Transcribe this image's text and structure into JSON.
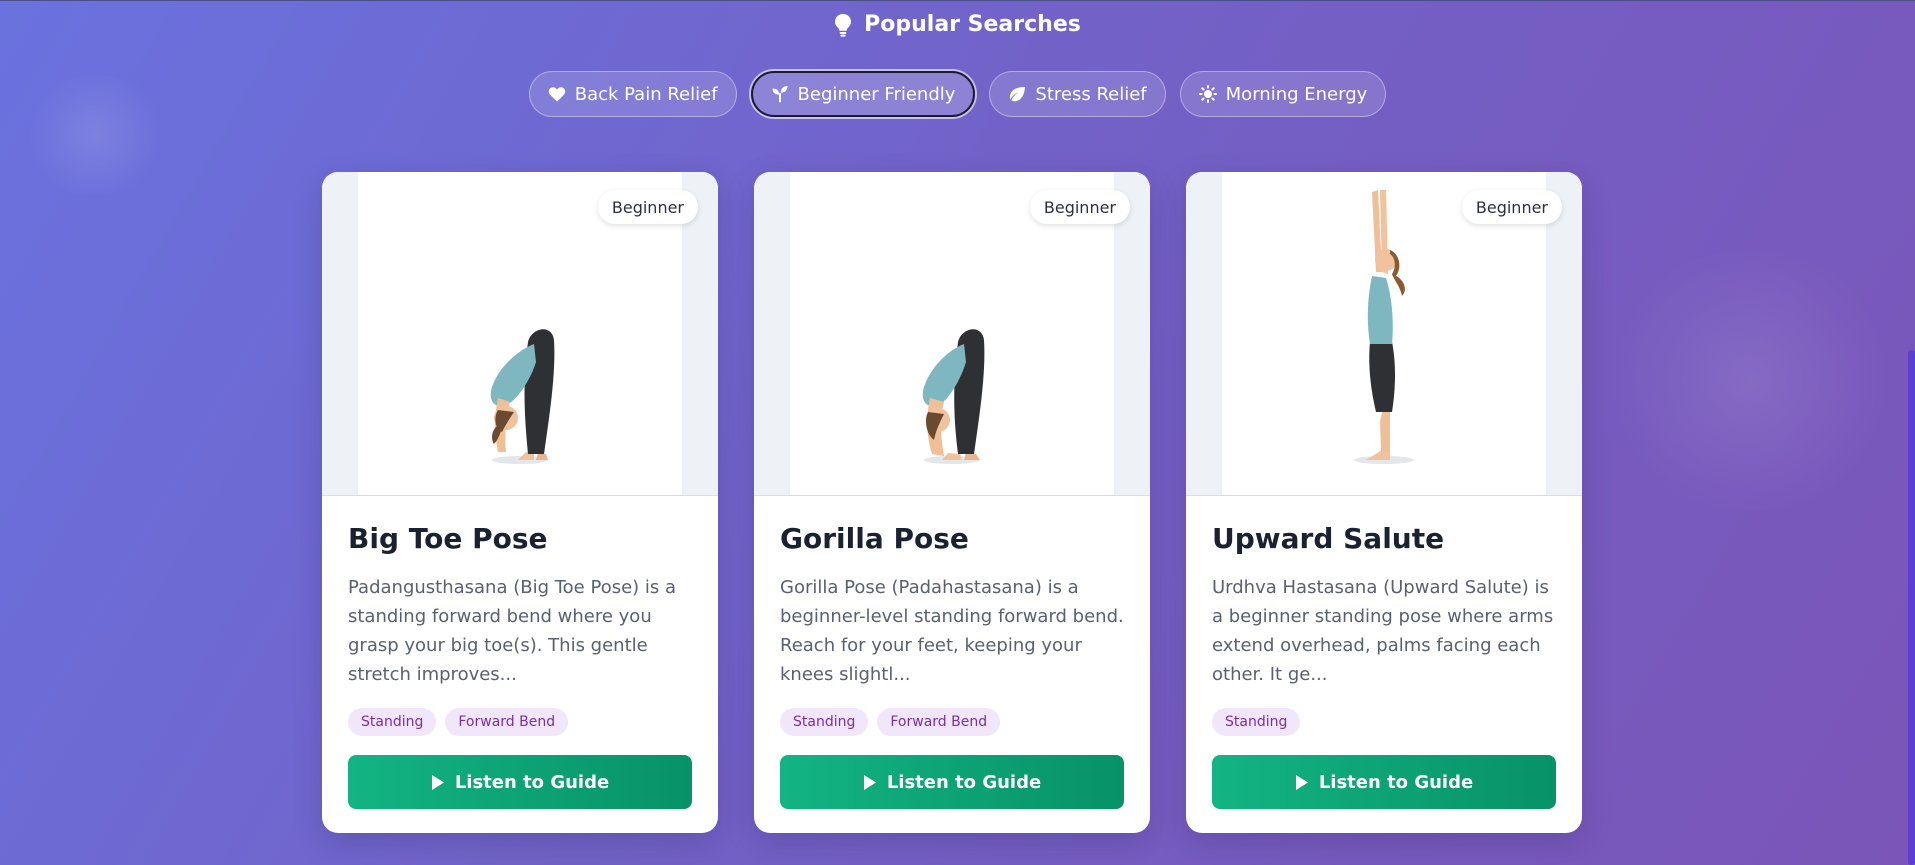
{
  "section": {
    "title": "Popular Searches",
    "icon": "lightbulb-icon"
  },
  "chips": [
    {
      "label": "Back Pain Relief",
      "icon": "heart-icon",
      "active": false
    },
    {
      "label": "Beginner Friendly",
      "icon": "seedling-icon",
      "active": true
    },
    {
      "label": "Stress Relief",
      "icon": "leaf-icon",
      "active": false
    },
    {
      "label": "Morning Energy",
      "icon": "sun-icon",
      "active": false
    }
  ],
  "cards": [
    {
      "level": "Beginner",
      "title": "Big Toe Pose",
      "description": "Padangusthasana (Big Toe Pose) is a standing forward bend where you grasp your big toe(s). This gentle stretch improves...",
      "tags": [
        "Standing",
        "Forward Bend"
      ],
      "button": "Listen to Guide",
      "pose": "forward-bend"
    },
    {
      "level": "Beginner",
      "title": "Gorilla Pose",
      "description": "Gorilla Pose (Padahastasana) is a beginner-level standing forward bend. Reach for your feet, keeping your knees slightl...",
      "tags": [
        "Standing",
        "Forward Bend"
      ],
      "button": "Listen to Guide",
      "pose": "forward-bend"
    },
    {
      "level": "Beginner",
      "title": "Upward Salute",
      "description": "Urdhva Hastasana (Upward Salute) is a beginner standing pose where arms extend overhead, palms facing each other. It ge...",
      "tags": [
        "Standing"
      ],
      "button": "Listen to Guide",
      "pose": "upward-salute"
    }
  ],
  "colors": {
    "button_start": "#13b483",
    "button_end": "#079267",
    "tag_bg": "#f2e6fb",
    "tag_text": "#7a2fa3"
  }
}
